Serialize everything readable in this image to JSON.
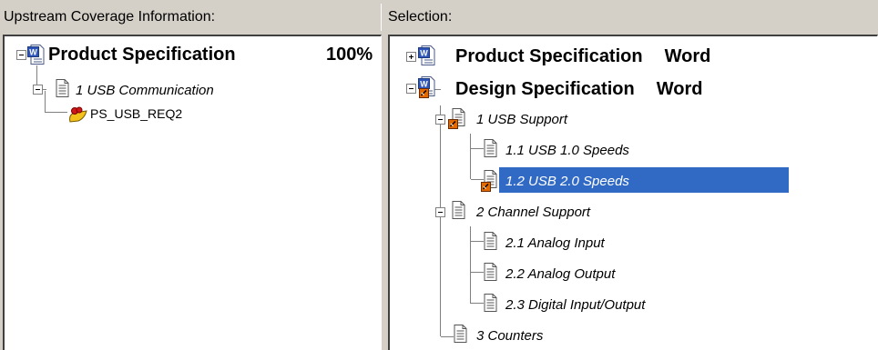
{
  "left_panel": {
    "header": "Upstream Coverage Information:",
    "tree": {
      "root_label": "Product Specification",
      "root_percent": "100%",
      "child_label": "1 USB Communication",
      "leaf_label": "PS_USB_REQ2"
    }
  },
  "right_panel": {
    "header": "Selection:",
    "tree": {
      "doc1_label": "Product Specification",
      "doc1_type": "Word",
      "doc2_label": "Design Specification",
      "doc2_type": "Word",
      "items": [
        "1 USB Support",
        "1.1 USB 1.0 Speeds",
        "1.2 USB 2.0 Speeds",
        "2 Channel Support",
        "2.1 Analog Input",
        "2.2 Analog Output",
        "2.3 Digital Input/Output",
        "3 Counters"
      ],
      "selected_item": "1.2 USB 2.0 Speeds"
    }
  },
  "icons": {
    "word_doc": "word-document-icon",
    "page": "page-icon",
    "linked_page": "linked-page-icon",
    "requirement": "requirement-icon"
  },
  "colors": {
    "selection": "#316ac5",
    "panel_bg": "#ffffff",
    "chrome_bg": "#d4d0c8",
    "link_badge": "#e46a00"
  }
}
